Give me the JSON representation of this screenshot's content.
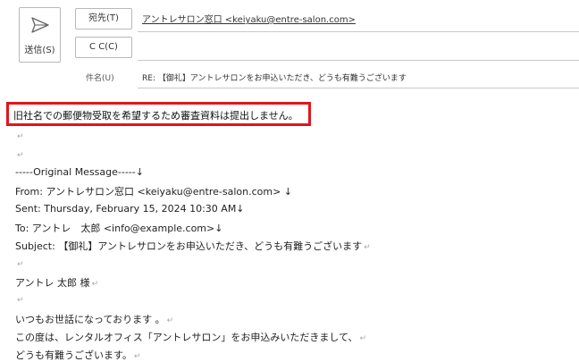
{
  "header": {
    "send_label": "送信(S)",
    "to_button": "宛先(T)",
    "cc_button": "C C(C)",
    "to_value": "アントレサロン窓口 <keiyaku@entre-salon.com>",
    "subject_label": "件名(U)",
    "subject_value": "RE: 【御礼】アントレサロンをお申込いただき、どうも有難うございます"
  },
  "note": "旧社名での郵便物受取を希望するため審査資料は提出しません。",
  "return_mark": "↵",
  "body_lines": [
    "",
    "",
    "-----Original Message-----↓",
    "From: アントレサロン窓口 <keiyaku@entre-salon.com> ↓",
    "Sent: Thursday, February 15, 2024 10:30 AM↓",
    "To: アントレ　太郎 <info@example.com>↓",
    "Subject: 【御礼】アントレサロンをお申込いただき、どうも有難うございます",
    "",
    "アントレ 太郎 様",
    "",
    "いつもお世話になっております 。",
    "この度は、レンタルオフィス「アントレサロン」をお申込みいただきまして、",
    "どうも有難うございます。"
  ]
}
